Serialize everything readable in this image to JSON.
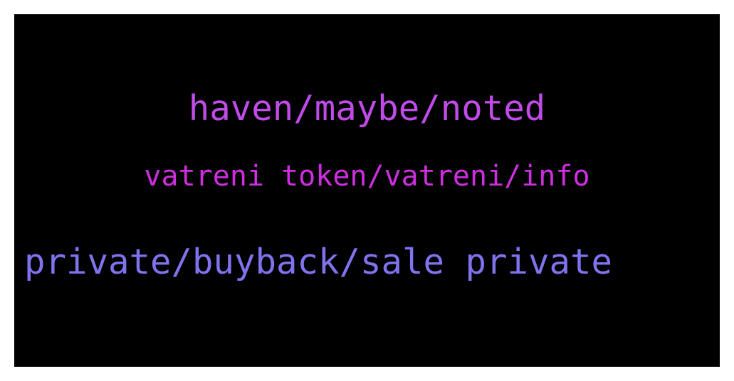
{
  "word_cloud": {
    "background": "#000000",
    "lines": [
      {
        "text": "haven/maybe/noted",
        "color": "#c04be8"
      },
      {
        "text": "vatreni token/vatreni/info",
        "color": "#cf2ee0"
      },
      {
        "text": "private/buyback/sale private",
        "color": "#7f73ee"
      }
    ]
  }
}
